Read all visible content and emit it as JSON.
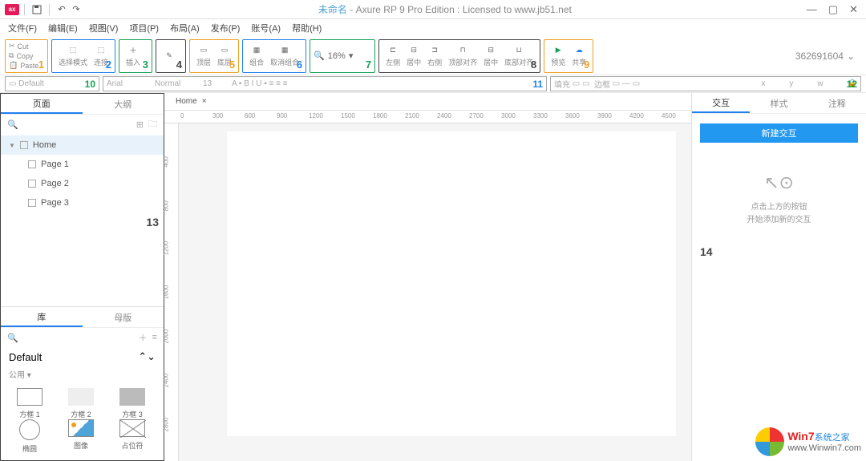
{
  "titlebar": {
    "logo": "ax",
    "unnamed": "未命名",
    "suffix": " - Axure RP 9 Pro Edition : Licensed to www.jb51.net"
  },
  "menu": [
    "文件(F)",
    "编辑(E)",
    "视图(V)",
    "项目(P)",
    "布局(A)",
    "发布(P)",
    "账号(A)",
    "帮助(H)"
  ],
  "toolbar": {
    "clip": {
      "cut": "Cut",
      "copy": "Copy",
      "paste": "Paste"
    },
    "g2": {
      "a": "选择模式",
      "b": "连接"
    },
    "g3": "插入",
    "g5": {
      "a": "顶层",
      "b": "底层"
    },
    "g6": {
      "a": "组合",
      "b": "取消组合"
    },
    "zoom": "16%",
    "g8": {
      "a": "左侧",
      "b": "居中",
      "c": "右侧",
      "d": "顶部对齐",
      "e": "居中",
      "f": "底部对齐"
    },
    "g9": {
      "a": "预览",
      "b": "共享"
    },
    "id": "362691604"
  },
  "propbar": {
    "style": "Default",
    "font": "Arial",
    "weight": "Normal",
    "size": "13",
    "fill": "填充",
    "border": "边框",
    "x": "x",
    "y": "y",
    "w": "w"
  },
  "left": {
    "tabs": {
      "page": "页面",
      "outline": "大纲"
    },
    "tree": {
      "home": "Home",
      "p1": "Page 1",
      "p2": "Page 2",
      "p3": "Page 3"
    },
    "lib_tabs": {
      "lib": "库",
      "master": "母版"
    },
    "lib_title": "Default",
    "lib_sub": "公用 ▾",
    "widgets": {
      "b1": "方框 1",
      "b2": "方框 2",
      "b3": "方框 3",
      "el": "椭圆",
      "img": "图像",
      "ph": "占位符"
    }
  },
  "canvas": {
    "tab": "Home",
    "ruler_h": [
      "0",
      "300",
      "600",
      "900",
      "1200",
      "1500",
      "1800",
      "2100",
      "2400",
      "2700",
      "3000",
      "3300",
      "3600",
      "3900",
      "4200",
      "4500"
    ],
    "ruler_v": [
      "400",
      "800",
      "1200",
      "1600",
      "2000",
      "2400",
      "2800"
    ]
  },
  "right": {
    "tabs": {
      "inter": "交互",
      "style": "样式",
      "notes": "注释"
    },
    "new_btn": "新建交互",
    "hint1": "点击上方的按钮",
    "hint2": "开始添加新的交互"
  },
  "watermark": {
    "brand": "Win7",
    "suffix": "系统之家",
    "url": "www.Winwin7.com"
  },
  "nums": {
    "n1": "1",
    "n2": "2",
    "n3": "3",
    "n4": "4",
    "n5": "5",
    "n6": "6",
    "n7": "7",
    "n8": "8",
    "n9": "9",
    "n10": "10",
    "n11": "11",
    "n12": "12",
    "n13": "13",
    "n14": "14"
  }
}
